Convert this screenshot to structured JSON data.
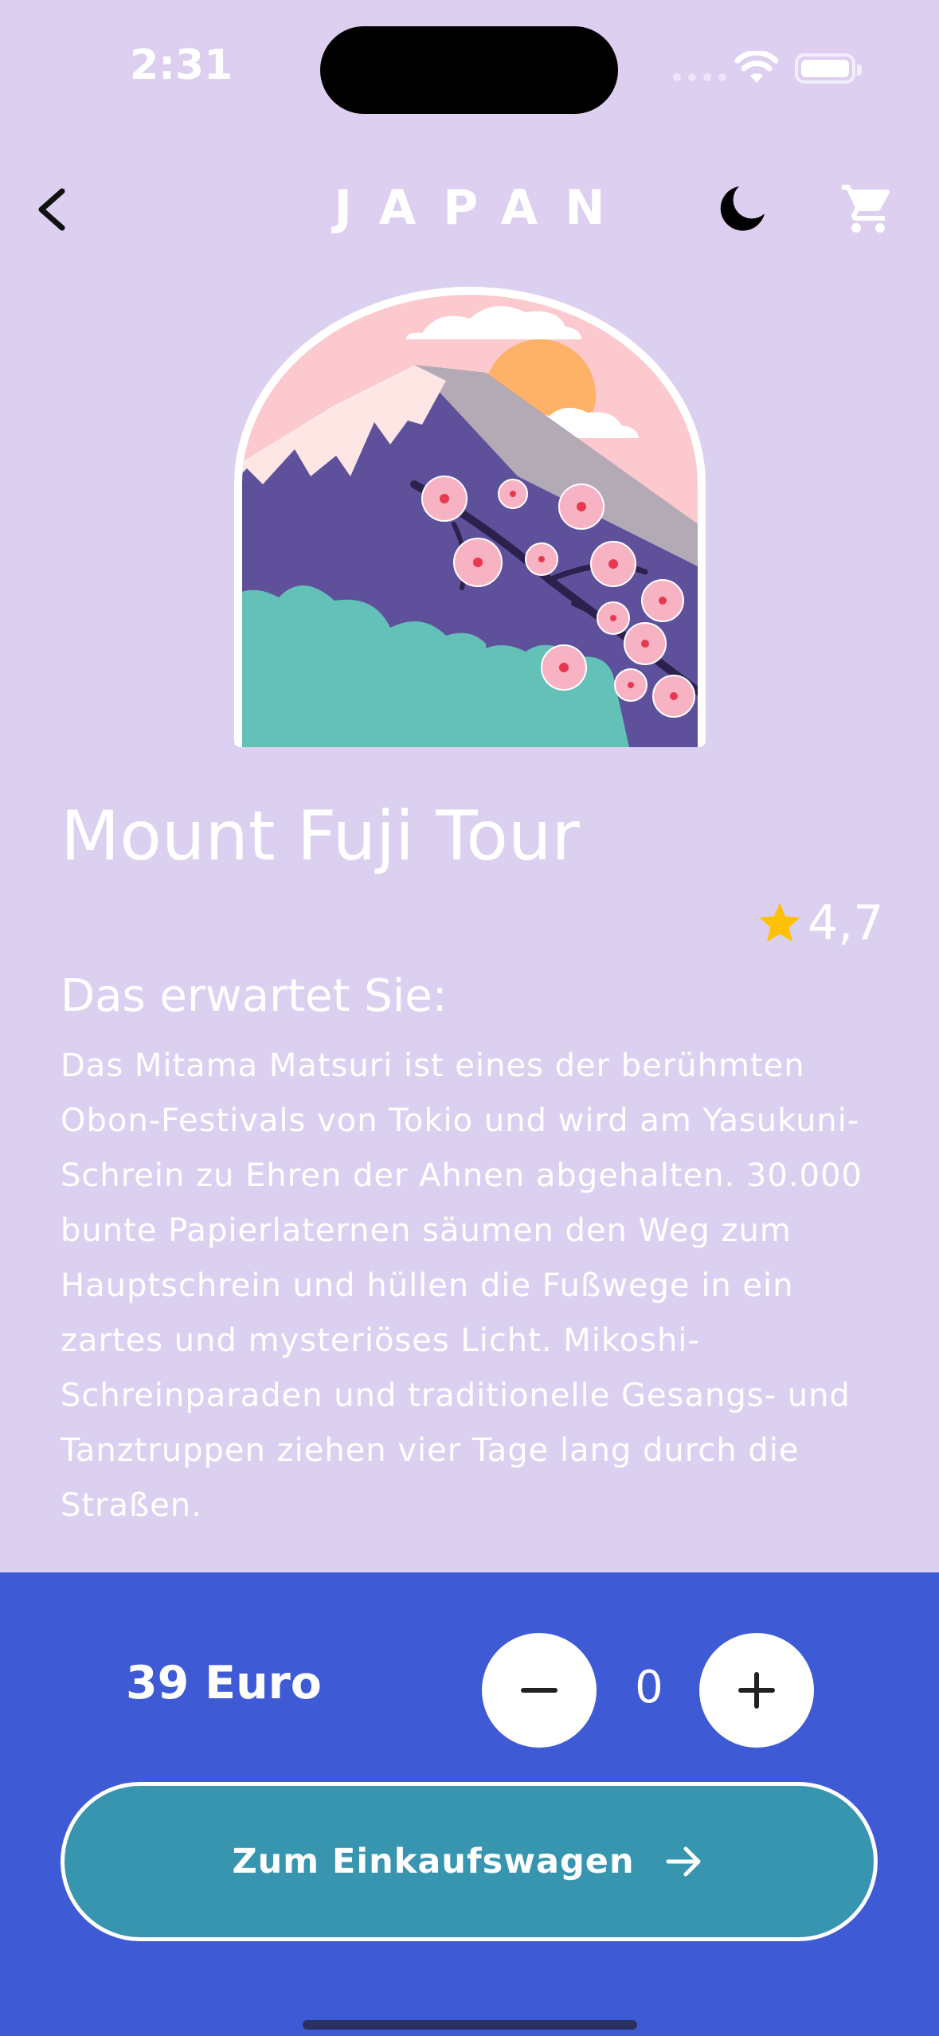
{
  "status_bar": {
    "time": "2:31"
  },
  "header": {
    "title": "JAPAN",
    "back_icon": "chevron-left-icon",
    "theme_icon": "moon-icon",
    "cart_icon": "shopping-cart-icon"
  },
  "product": {
    "name": "Mount Fuji Tour",
    "rating": "4,7",
    "subheading": "Das erwartet Sie:",
    "description": "Das Mitama Matsuri ist eines der berühmten Obon-Festivals von Tokio und wird am Yasukuni-Schrein zu Ehren der Ahnen abgehalten. 30.000 bunte Papierlaternen säumen den Weg zum Hauptschrein und hüllen die Fußwege in ein zartes und mysteriöses Licht. Mikoshi-Schreinparaden und traditionelle Gesangs- und Tanztruppen ziehen vier Tage lang durch die Straßen."
  },
  "purchase": {
    "price": "39 Euro",
    "quantity": "0",
    "cta_label": "Zum Einkaufswagen",
    "cta_icon": "arrow-right-icon"
  },
  "colors": {
    "background": "#dcd0f1",
    "bottom_panel": "#3e5ad5",
    "cta_button": "#3795b0",
    "star": "#ffc107"
  }
}
